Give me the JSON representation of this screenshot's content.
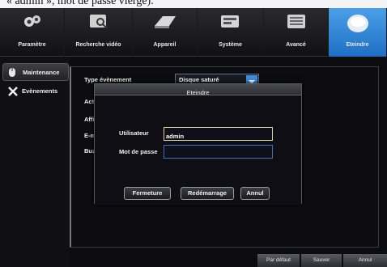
{
  "caption": "« admin », mot de passe vierge).",
  "tabs": [
    {
      "label": "Paramètre",
      "icon": "gears-icon"
    },
    {
      "label": "Recherche vidéo",
      "icon": "video-search-icon"
    },
    {
      "label": "Appareil",
      "icon": "hard-drive-icon"
    },
    {
      "label": "Système",
      "icon": "system-icon"
    },
    {
      "label": "Avancé",
      "icon": "advanced-icon"
    },
    {
      "label": "Eteindre",
      "icon": "power-icon"
    }
  ],
  "sidebar": {
    "items": [
      {
        "label": "Maintenance",
        "icon": "mouse-icon"
      },
      {
        "label": "Evènements",
        "icon": "tools-icon"
      }
    ]
  },
  "form": {
    "type_label": "Type évènement",
    "type_value": "Disque saturé",
    "activer_label": "Acti",
    "afficher_label": "Affic",
    "email_label": "E-m",
    "buzzer_label": "Buzz"
  },
  "footer": {
    "default_label": "Par défaut",
    "save_label": "Sauver",
    "cancel_label": "Annul"
  },
  "dialog": {
    "title": "Eteindre",
    "user_label": "Utilisateur",
    "user_value": "admin",
    "password_label": "Mot de passe",
    "password_value": "",
    "shutdown_label": "Fermeture",
    "restart_label": "Redémarrage",
    "cancel_label": "Annul"
  },
  "colors": {
    "accent": "#3d8ce0",
    "active_tab": "#2a7fd4",
    "focus_border": "#d8d58a"
  }
}
